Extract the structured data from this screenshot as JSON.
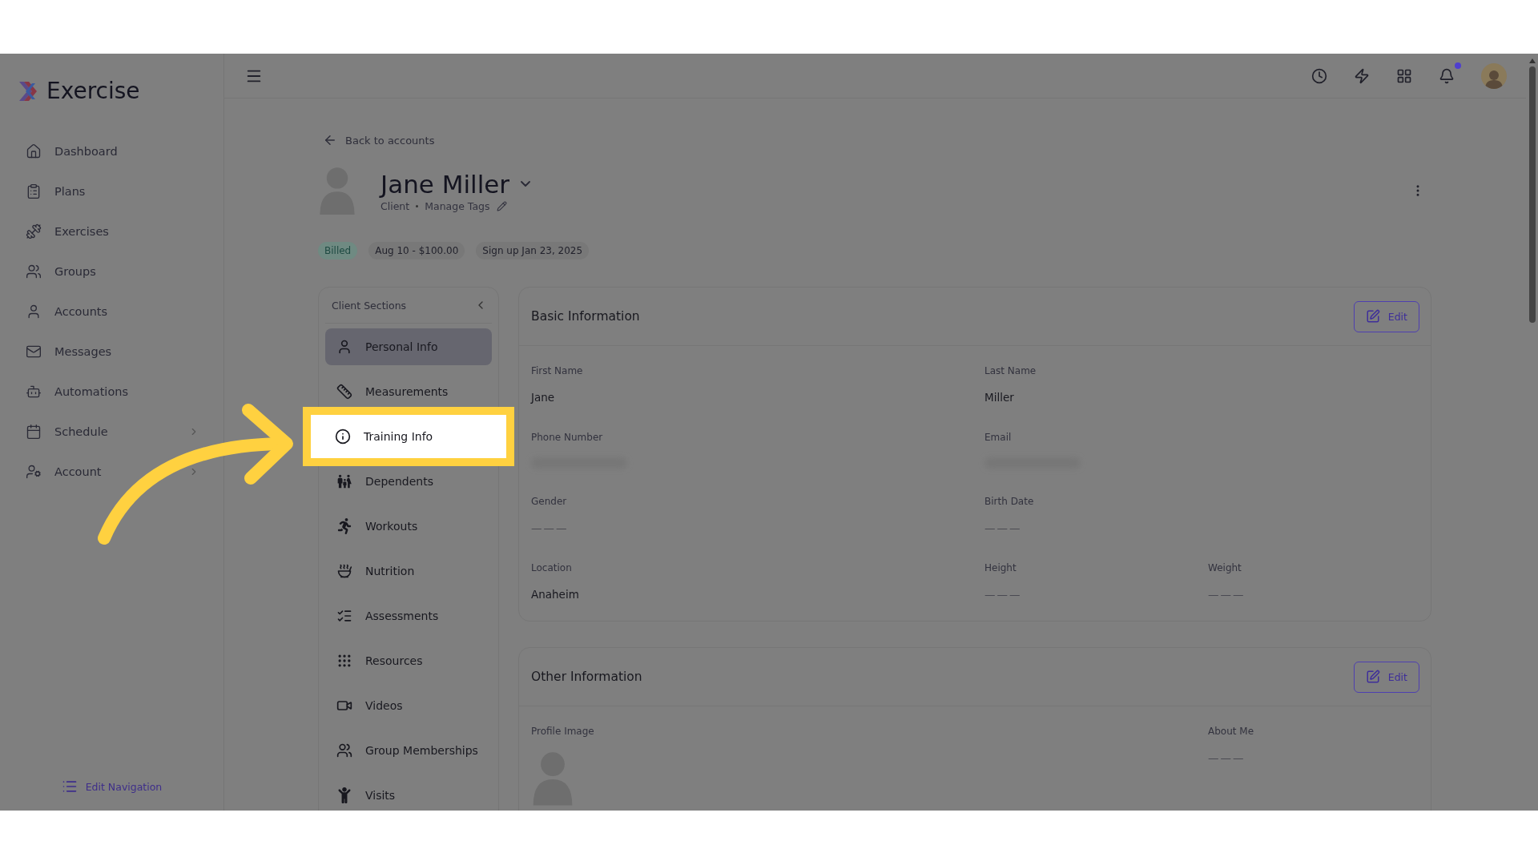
{
  "app": {
    "name": "Exercise"
  },
  "sidebar": {
    "items": [
      {
        "label": "Dashboard",
        "expandable": false
      },
      {
        "label": "Plans",
        "expandable": false
      },
      {
        "label": "Exercises",
        "expandable": false
      },
      {
        "label": "Groups",
        "expandable": false
      },
      {
        "label": "Accounts",
        "expandable": false
      },
      {
        "label": "Messages",
        "expandable": false
      },
      {
        "label": "Automations",
        "expandable": false
      },
      {
        "label": "Schedule",
        "expandable": true
      },
      {
        "label": "Account",
        "expandable": true
      }
    ],
    "edit_navigation": "Edit Navigation"
  },
  "topbar": {
    "notifications_unread": true
  },
  "back_link": "Back to accounts",
  "profile": {
    "name": "Jane Miller",
    "role": "Client",
    "tags_link": "Manage Tags"
  },
  "badges": [
    {
      "label": "Billed",
      "kind": "status"
    },
    {
      "label": "Aug 10 - $100.00",
      "kind": "info"
    },
    {
      "label": "Sign up Jan 23, 2025",
      "kind": "info"
    }
  ],
  "client_sections": {
    "title": "Client Sections",
    "items": [
      {
        "label": "Personal Info",
        "selected": true,
        "highlighted": false
      },
      {
        "label": "Measurements",
        "selected": false,
        "highlighted": false
      },
      {
        "label": "Training Info",
        "selected": false,
        "highlighted": true
      },
      {
        "label": "Dependents",
        "selected": false,
        "highlighted": false
      },
      {
        "label": "Workouts",
        "selected": false,
        "highlighted": false
      },
      {
        "label": "Nutrition",
        "selected": false,
        "highlighted": false
      },
      {
        "label": "Assessments",
        "selected": false,
        "highlighted": false
      },
      {
        "label": "Resources",
        "selected": false,
        "highlighted": false
      },
      {
        "label": "Videos",
        "selected": false,
        "highlighted": false
      },
      {
        "label": "Group Memberships",
        "selected": false,
        "highlighted": false
      },
      {
        "label": "Visits",
        "selected": false,
        "highlighted": false
      }
    ]
  },
  "basic_information": {
    "title": "Basic Information",
    "edit": "Edit",
    "fields": [
      {
        "label": "First Name",
        "kind": "text",
        "value": "Jane"
      },
      {
        "label": "Last Name",
        "kind": "text",
        "value": "Miller"
      },
      {
        "label": "Phone Number",
        "kind": "redacted"
      },
      {
        "label": "Email",
        "kind": "redacted"
      },
      {
        "label": "Gender",
        "kind": "empty",
        "value": "———"
      },
      {
        "label": "Birth Date",
        "kind": "empty",
        "value": "———"
      },
      {
        "label": "Location",
        "kind": "text",
        "value": "Anaheim"
      },
      {
        "label": "Height",
        "kind": "empty",
        "value": "———"
      },
      {
        "label": "Weight",
        "kind": "empty",
        "value": "———"
      }
    ]
  },
  "other_information": {
    "title": "Other Information",
    "edit": "Edit",
    "fields": [
      {
        "label": "Profile Image",
        "kind": "image"
      },
      {
        "label": "About Me",
        "kind": "empty",
        "value": "———"
      }
    ]
  }
}
